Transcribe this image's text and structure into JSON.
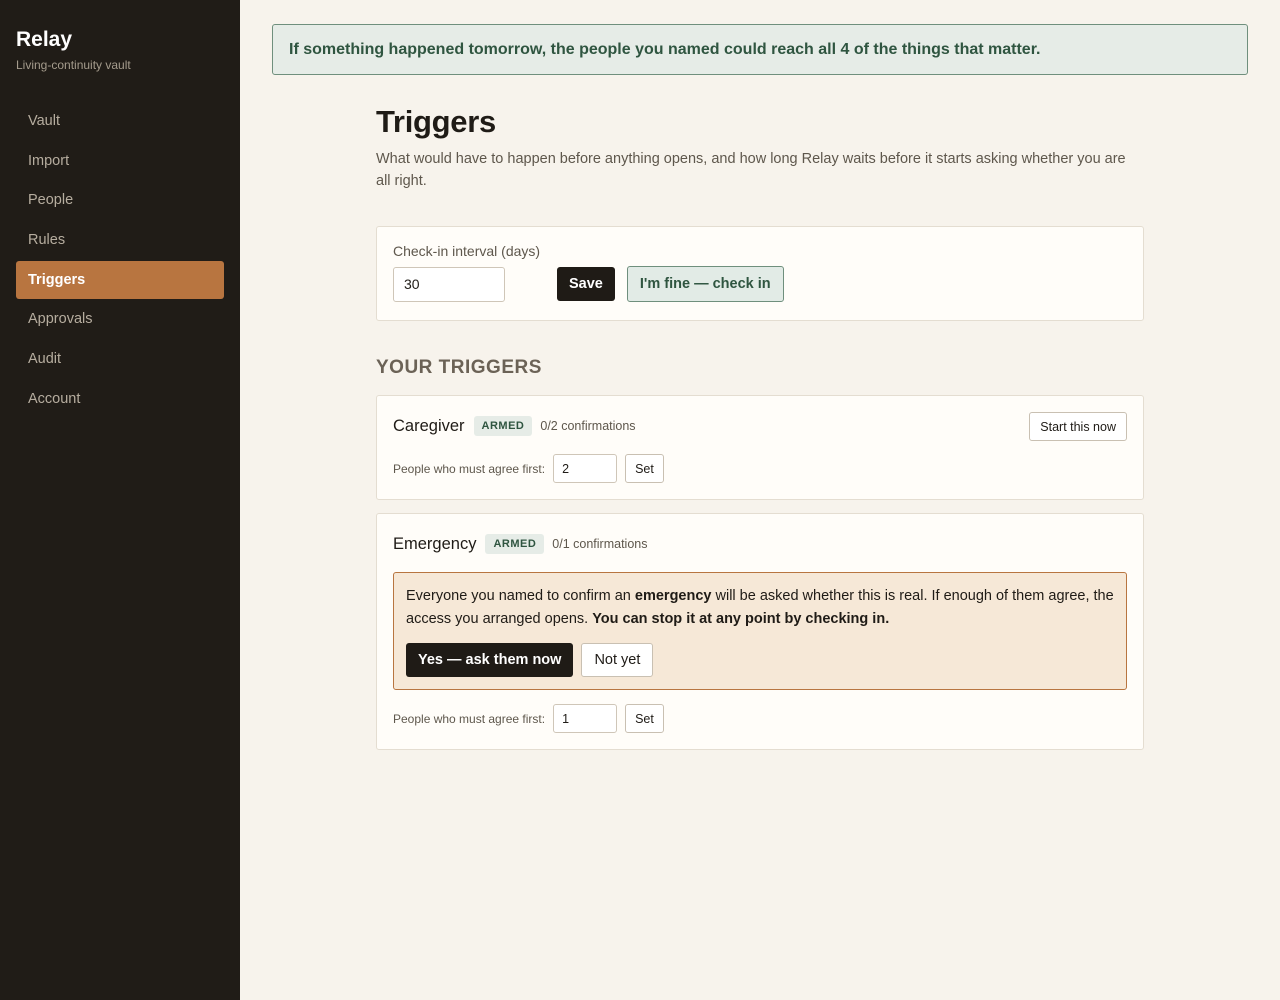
{
  "sidebar": {
    "brand": "Relay",
    "tagline": "Living-continuity vault",
    "items": [
      {
        "label": "Vault"
      },
      {
        "label": "Import"
      },
      {
        "label": "People"
      },
      {
        "label": "Rules"
      },
      {
        "label": "Triggers",
        "active": true
      },
      {
        "label": "Approvals"
      },
      {
        "label": "Audit"
      },
      {
        "label": "Account"
      }
    ]
  },
  "banner": {
    "text": "If something happened tomorrow, the people you named could reach all 4 of the things that matter."
  },
  "page": {
    "title": "Triggers",
    "description": "What would have to happen before anything opens, and how long Relay waits before it starts asking whether you are all right."
  },
  "checkin": {
    "label": "Check-in interval (days)",
    "value": "30",
    "save_label": "Save",
    "checkin_label": "I'm fine — check in"
  },
  "triggers_section": {
    "heading": "YOUR TRIGGERS"
  },
  "triggers": [
    {
      "name": "Caregiver",
      "status": "ARMED",
      "confirmations": "0/2 confirmations",
      "start_label": "Start this now",
      "agree_label": "People who must agree first:",
      "agree_value": "2",
      "set_label": "Set"
    },
    {
      "name": "Emergency",
      "status": "ARMED",
      "confirmations": "0/1 confirmations",
      "notice": {
        "part1": "Everyone you named to confirm an ",
        "bold1": "emergency",
        "part2": " will be asked whether this is real. If enough of them agree, the access you arranged opens. ",
        "bold2": "You can stop it at any point by checking in.",
        "confirm_label": "Yes — ask them now",
        "cancel_label": "Not yet"
      },
      "agree_label": "People who must agree first:",
      "agree_value": "1",
      "set_label": "Set"
    }
  ],
  "colors": {
    "sidebar_bg": "#201c17",
    "accent": "#b87540",
    "success": "#2f5540",
    "page_bg": "#f7f3ec"
  }
}
